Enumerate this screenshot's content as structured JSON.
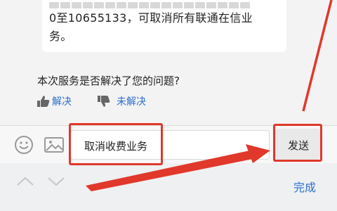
{
  "message": {
    "line2": "0至10655133，可取消所有联通在信业",
    "line3": "务。"
  },
  "feedback": {
    "question": "本次服务是否解决了您的问题?",
    "solved_label": "解决",
    "unsolved_label": "未解决"
  },
  "input": {
    "value": "取消收费业务",
    "send_label": "发送"
  },
  "keyboard": {
    "done_label": "完成"
  },
  "colors": {
    "accent": "#2b6fcf",
    "annotation": "#e0382b"
  },
  "icons": [
    "emoji-icon",
    "image-icon",
    "thumbs-up-icon",
    "thumbs-down-icon",
    "chevron-up-icon",
    "chevron-down-icon"
  ]
}
